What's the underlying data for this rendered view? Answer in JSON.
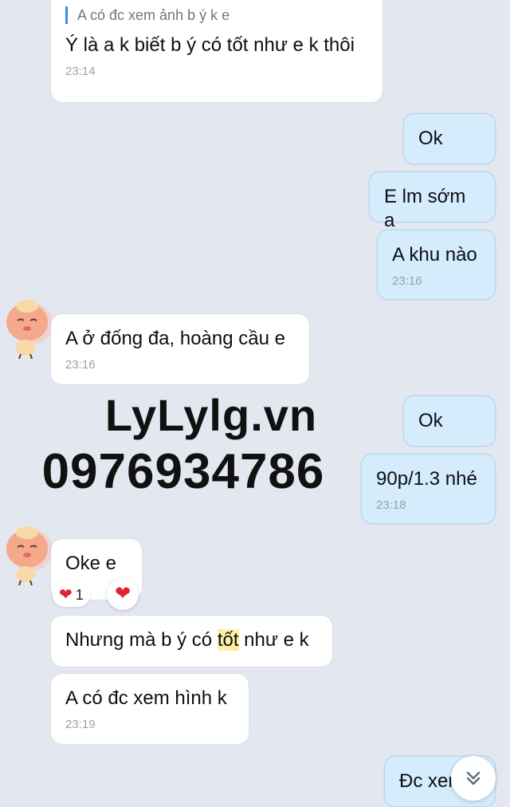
{
  "messages": [
    {
      "id": "m1",
      "direction": "in",
      "quote": "A có đc xem ảnh b ý k e",
      "text": "Ý là a k biết b ý có tốt như e k thôi",
      "time": "23:14"
    },
    {
      "id": "m2",
      "direction": "out",
      "text": "Ok"
    },
    {
      "id": "m3",
      "direction": "out",
      "text": "E lm sớm a"
    },
    {
      "id": "m4",
      "direction": "out",
      "text": "A khu nào",
      "time": "23:16"
    },
    {
      "id": "m5",
      "direction": "in",
      "text": "A ở đống đa, hoàng cầu e",
      "time": "23:16"
    },
    {
      "id": "m6",
      "direction": "out",
      "text": "Ok"
    },
    {
      "id": "m7",
      "direction": "out",
      "text": "90p/1.3 nhé",
      "time": "23:18"
    },
    {
      "id": "m8",
      "direction": "in",
      "text": "Oke e",
      "reaction": {
        "emoji": "❤",
        "count": "1"
      }
    },
    {
      "id": "m9",
      "direction": "in",
      "text_before": "Nhưng mà b ý có ",
      "text_highlight": "tốt",
      "text_after": " như e k"
    },
    {
      "id": "m10",
      "direction": "in",
      "text": "A có đc xem hình k",
      "time": "23:19"
    },
    {
      "id": "m11",
      "direction": "out",
      "text": "Đc xem"
    }
  ],
  "watermark": {
    "site": "LyLylg.vn",
    "phone": "0976934786"
  },
  "reaction_button": {
    "icon": "heart-icon"
  },
  "scroll_button": {
    "icon": "double-chevron-down-icon"
  },
  "colors": {
    "background": "#e3e7f0",
    "incoming_bubble": "#ffffff",
    "outgoing_bubble": "#d4ecfb",
    "quote_bar": "#3c8fe0",
    "highlight": "#fdeea0",
    "heart": "#e5232f"
  }
}
